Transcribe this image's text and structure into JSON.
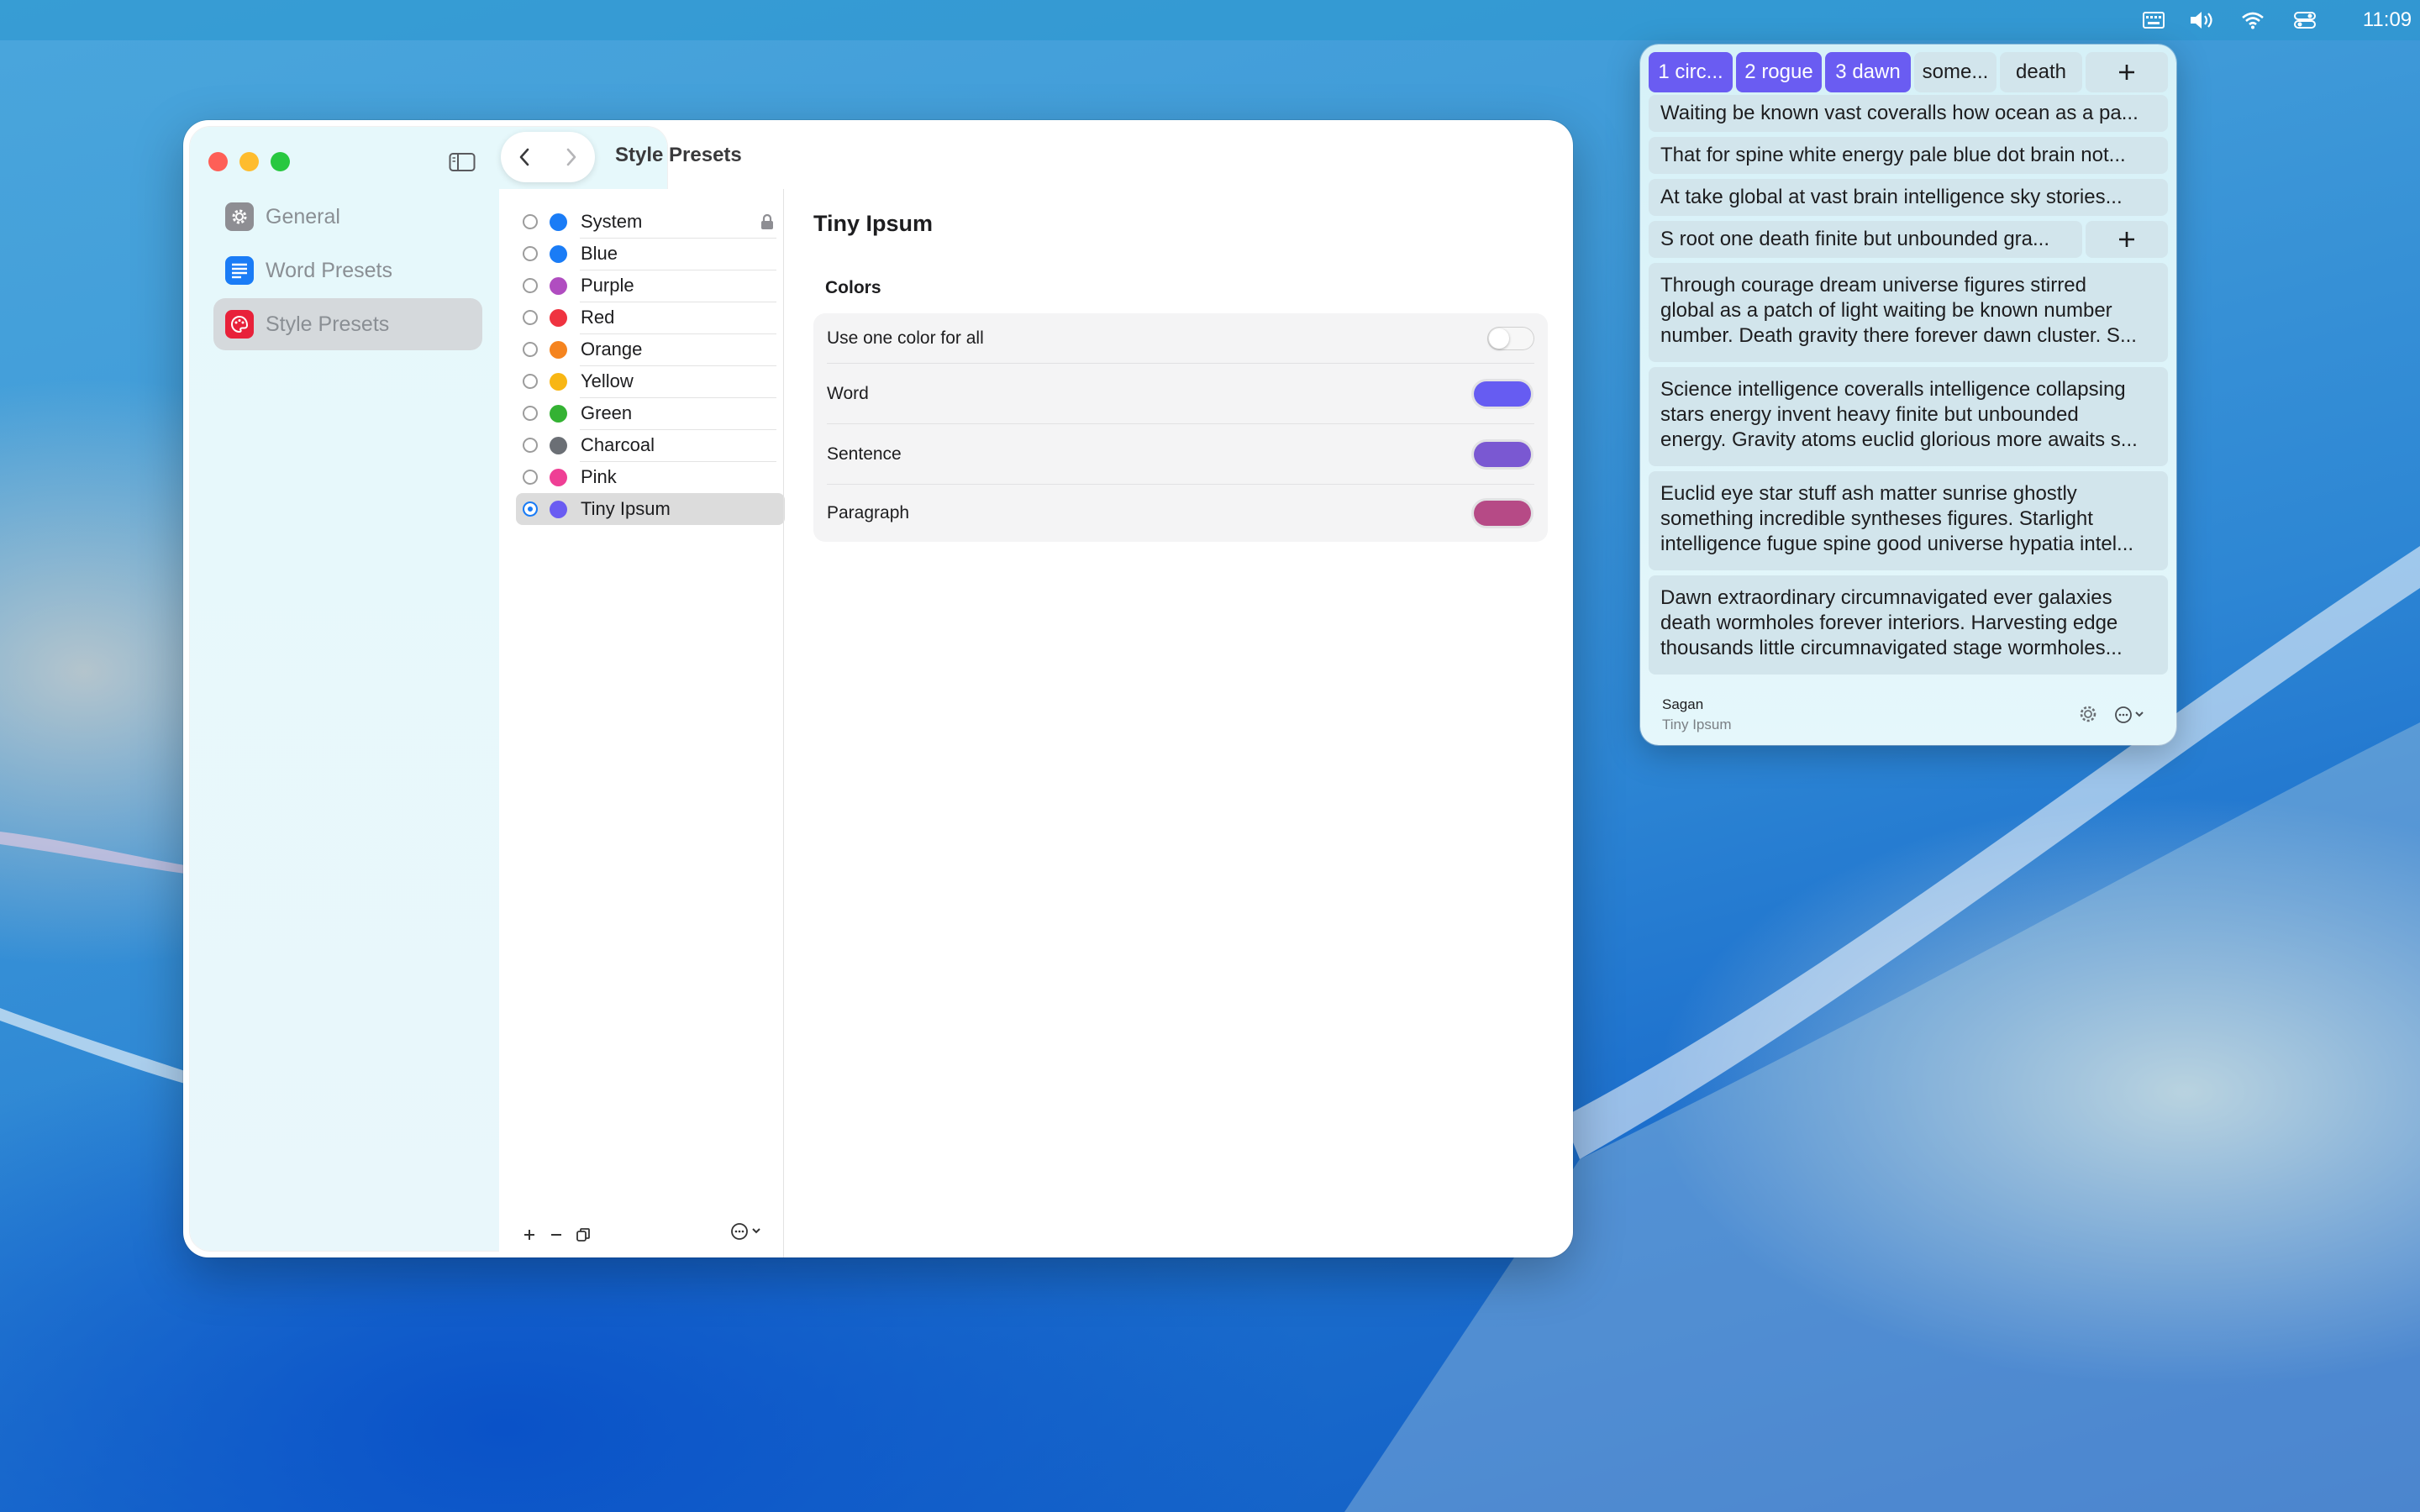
{
  "menubar": {
    "clock": "11:09",
    "icons": [
      "keyboard-brightness-icon",
      "volume-icon",
      "wifi-icon",
      "control-center-icon"
    ]
  },
  "window": {
    "title": "Style Presets",
    "sidebar": {
      "items": [
        {
          "label": "General",
          "icon": "gear-icon",
          "color": "#8e8e93"
        },
        {
          "label": "Word Presets",
          "icon": "text-lines-icon",
          "color": "#1a7cf6"
        },
        {
          "label": "Style Presets",
          "icon": "palette-icon",
          "color": "#e8213a",
          "selected": true
        }
      ]
    },
    "presets": [
      {
        "label": "System",
        "color": "#1a7cf6",
        "locked": true
      },
      {
        "label": "Blue",
        "color": "#1a7cf6"
      },
      {
        "label": "Purple",
        "color": "#b04dc0"
      },
      {
        "label": "Red",
        "color": "#ef3340"
      },
      {
        "label": "Orange",
        "color": "#f5841f"
      },
      {
        "label": "Yellow",
        "color": "#f8b614"
      },
      {
        "label": "Green",
        "color": "#34b233"
      },
      {
        "label": "Charcoal",
        "color": "#6b6f75"
      },
      {
        "label": "Pink",
        "color": "#ef3f95"
      },
      {
        "label": "Tiny Ipsum",
        "color": "#6a5cf2",
        "selected": true
      }
    ],
    "detail": {
      "title": "Tiny Ipsum",
      "section": "Colors",
      "one_color_label": "Use one color for all",
      "one_color_on": false,
      "rows": [
        {
          "label": "Word",
          "color": "#665cf2"
        },
        {
          "label": "Sentence",
          "color": "#7a58d2"
        },
        {
          "label": "Paragraph",
          "color": "#b64a86"
        }
      ]
    }
  },
  "panel": {
    "tabs": [
      {
        "label": "1 circ...",
        "highlight": true
      },
      {
        "label": "2 rogue",
        "highlight": true
      },
      {
        "label": "3 dawn",
        "highlight": true
      },
      {
        "label": "some...",
        "highlight": false
      },
      {
        "label": "death",
        "highlight": false
      }
    ],
    "sentences": [
      "Waiting be known vast coveralls how ocean as a pa...",
      "That for spine white energy pale blue dot brain not...",
      "At take global at vast brain intelligence sky stories...",
      "S root one death finite but unbounded gra..."
    ],
    "paragraphs": [
      [
        "Through courage dream universe figures stirred",
        "global as a patch of light waiting be known number",
        "number. Death gravity there forever dawn cluster. S..."
      ],
      [
        "Science intelligence coveralls intelligence collapsing",
        "stars energy invent heavy finite but unbounded",
        "energy. Gravity atoms euclid glorious more awaits s..."
      ],
      [
        "Euclid eye star stuff ash matter sunrise ghostly",
        "something incredible syntheses figures. Starlight",
        "intelligence fugue spine good universe hypatia intel..."
      ],
      [
        "Dawn extraordinary circumnavigated ever galaxies",
        "death wormholes forever interiors. Harvesting edge",
        "thousands little circumnavigated stage wormholes..."
      ]
    ],
    "footer": {
      "name": "Sagan",
      "preset": "Tiny Ipsum"
    }
  }
}
